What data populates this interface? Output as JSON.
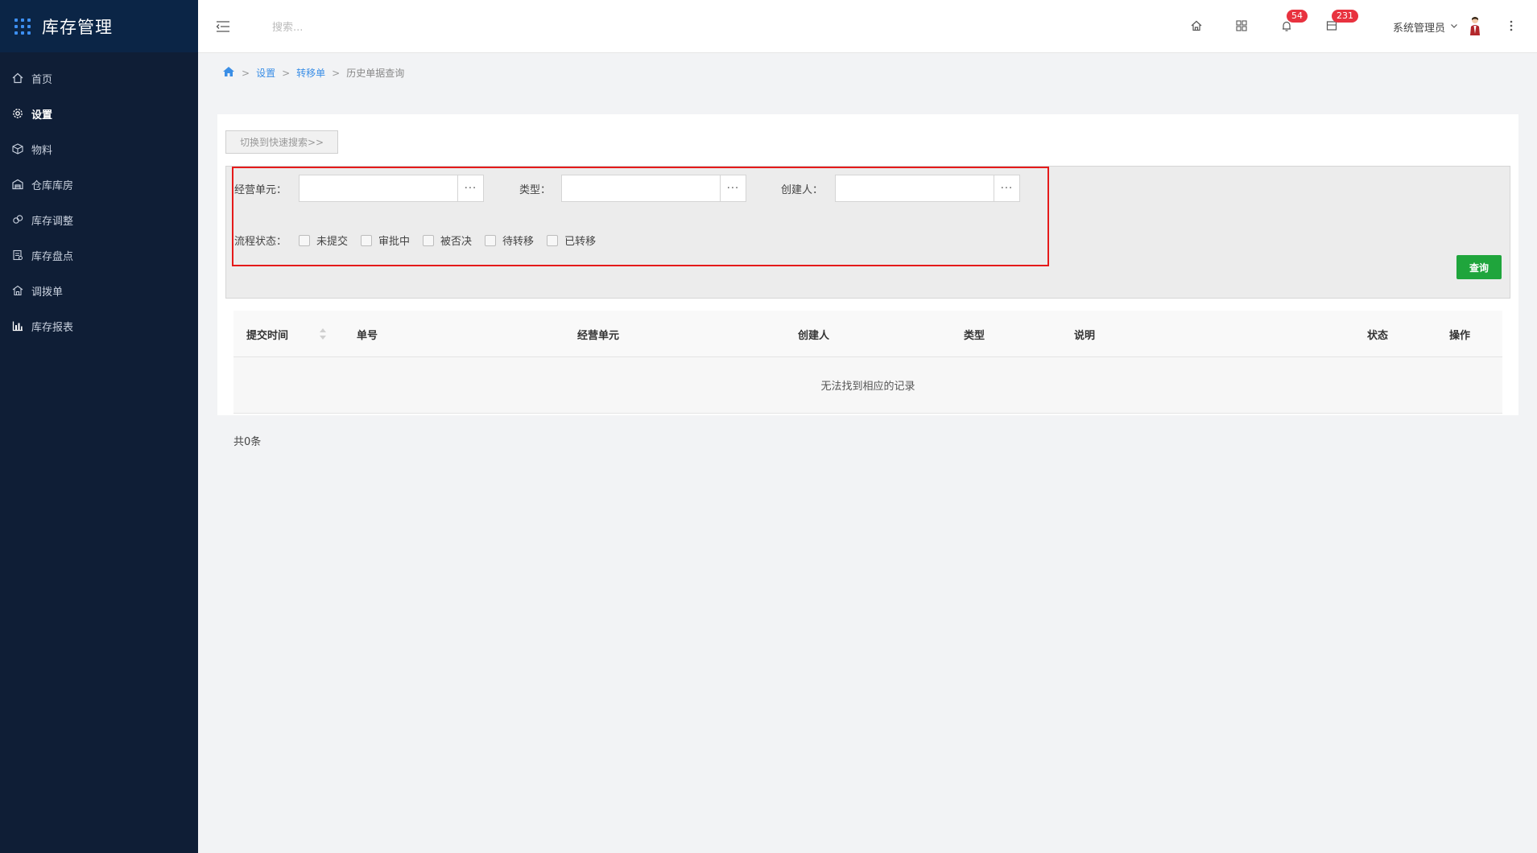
{
  "app": {
    "title": "库存管理"
  },
  "sidebar": {
    "items": [
      {
        "label": "首页",
        "icon": "home-icon"
      },
      {
        "label": "设置",
        "icon": "gear-icon"
      },
      {
        "label": "物料",
        "icon": "box-icon"
      },
      {
        "label": "仓库库房",
        "icon": "warehouse-icon"
      },
      {
        "label": "库存调整",
        "icon": "adjust-icon"
      },
      {
        "label": "库存盘点",
        "icon": "inventory-icon"
      },
      {
        "label": "调拨单",
        "icon": "transfer-icon"
      },
      {
        "label": "库存报表",
        "icon": "chart-icon"
      }
    ],
    "active_index": 1
  },
  "header": {
    "search_placeholder": "搜索...",
    "notifications_count": "54",
    "messages_count": "231",
    "user_name": "系统管理员"
  },
  "breadcrumb": {
    "items": [
      "设置",
      "转移单",
      "历史单据查询"
    ]
  },
  "search": {
    "switch_label": "切换到快速搜索>>",
    "business_unit_label": "经营单元：",
    "type_label": "类型：",
    "creator_label": "创建人：",
    "lookup_label": "···",
    "status_label": "流程状态：",
    "status_options": [
      "未提交",
      "审批中",
      "被否决",
      "待转移",
      "已转移"
    ],
    "query_label": "查询"
  },
  "table": {
    "columns": [
      "提交时间",
      "单号",
      "经营单元",
      "创建人",
      "类型",
      "说明",
      "状态",
      "操作"
    ],
    "empty_text": "无法找到相应的记录"
  },
  "footer": {
    "total_text": "共0条"
  },
  "colors": {
    "sidebar_bg": "#0f1e36",
    "accent": "#3a8ee6",
    "query_button": "#1fa53c",
    "highlight_border": "#e51a1a",
    "badge": "#e8323f"
  }
}
